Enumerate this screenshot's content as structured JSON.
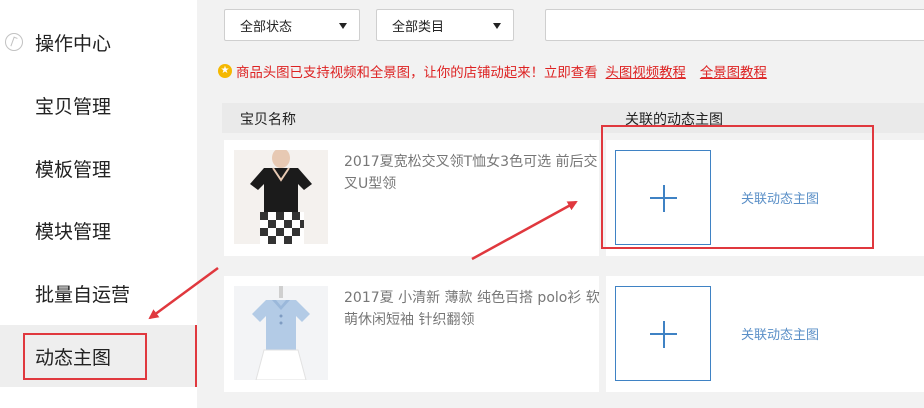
{
  "sidebar": {
    "items": [
      {
        "label": "操作中心"
      },
      {
        "label": "宝贝管理"
      },
      {
        "label": "模板管理"
      },
      {
        "label": "模块管理"
      },
      {
        "label": "批量自运营"
      },
      {
        "label": "动态主图"
      }
    ]
  },
  "filters": {
    "status": "全部状态",
    "category": "全部类目",
    "search_value": ""
  },
  "notice": {
    "text": "商品头图已支持视频和全景图，让你的店铺动起来！立即查看",
    "link1": "头图视频教程",
    "link2": "全景图教程",
    "color": "#dd2222"
  },
  "table": {
    "col_name": "宝贝名称",
    "col_pic": "关联的动态主图",
    "rows": [
      {
        "title": "2017夏宽松交叉领T恤女3色可选 前后交叉U型领",
        "link": "关联动态主图"
      },
      {
        "title": "2017夏 小清新 薄款 纯色百搭 polo衫 软萌休闲短袖 针织翻领",
        "link": "关联动态主图"
      }
    ]
  },
  "colors": {
    "highlight": "#e0383e",
    "accent": "#3f82c4",
    "link": "#5a8fc7"
  },
  "icons": {
    "nav_first": "operation-center-icon",
    "notice": "star-badge-icon",
    "add": "plus-icon",
    "caret": "caret-down-icon"
  }
}
